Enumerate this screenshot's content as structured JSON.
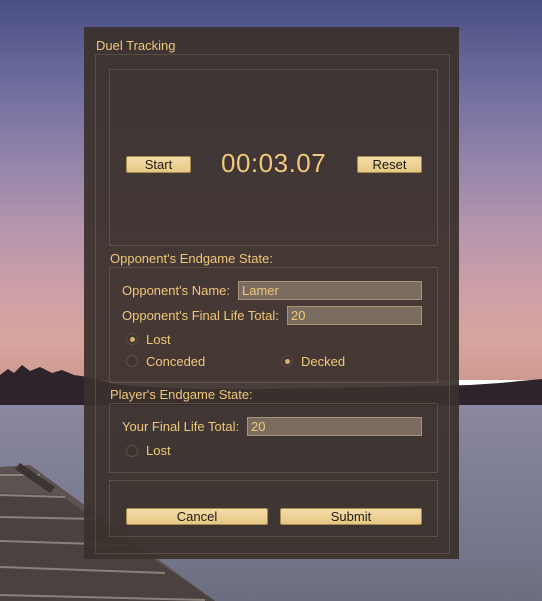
{
  "window": {
    "title": "Duel Tracking"
  },
  "timer": {
    "start_label": "Start",
    "value": "00:03.07",
    "reset_label": "Reset"
  },
  "opponent": {
    "section_label": "Opponent's Endgame State:",
    "name_label": "Opponent's Name:",
    "name_value": "Lamer",
    "life_label": "Opponent's Final Life Total:",
    "life_value": "20",
    "lost_label": "Lost",
    "lost_checked": true,
    "conceded_label": "Conceded",
    "conceded_checked": false,
    "decked_label": "Decked",
    "decked_checked": true
  },
  "player": {
    "section_label": "Player's Endgame State:",
    "life_label": "Your Final Life Total:",
    "life_value": "20",
    "lost_label": "Lost",
    "lost_checked": false
  },
  "actions": {
    "cancel_label": "Cancel",
    "submit_label": "Submit"
  },
  "colors": {
    "accent": "#f0c87a",
    "panel": "#3a302c",
    "button": "#efd49a"
  }
}
